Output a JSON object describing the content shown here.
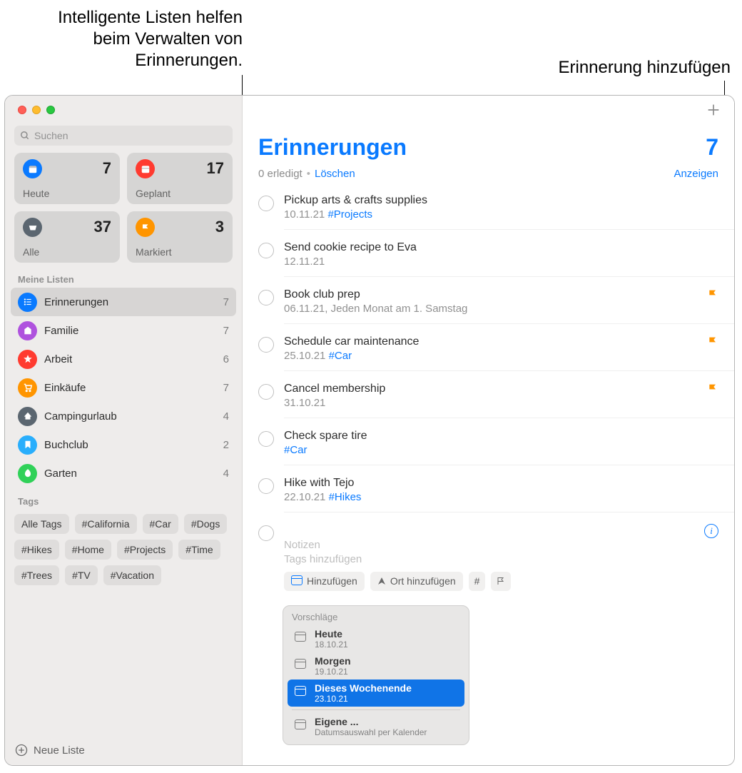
{
  "callouts": {
    "smart_lists": "Intelligente Listen helfen beim Verwalten von Erinnerungen.",
    "add_reminder": "Erinnerung hinzufügen"
  },
  "search": {
    "placeholder": "Suchen"
  },
  "smart": [
    {
      "label": "Heute",
      "count": "7",
      "color": "#0a7aff",
      "icon": "today"
    },
    {
      "label": "Geplant",
      "count": "17",
      "color": "#ff3b30",
      "icon": "scheduled"
    },
    {
      "label": "Alle",
      "count": "37",
      "color": "#5b6670",
      "icon": "all"
    },
    {
      "label": "Markiert",
      "count": "3",
      "color": "#ff9500",
      "icon": "flag"
    }
  ],
  "sections": {
    "lists": "Meine Listen",
    "tags": "Tags"
  },
  "lists": [
    {
      "label": "Erinnerungen",
      "count": "7",
      "color": "#0a7aff",
      "selected": true
    },
    {
      "label": "Familie",
      "count": "7",
      "color": "#af52de",
      "selected": false
    },
    {
      "label": "Arbeit",
      "count": "6",
      "color": "#ff3b30",
      "selected": false
    },
    {
      "label": "Einkäufe",
      "count": "7",
      "color": "#ff9500",
      "selected": false
    },
    {
      "label": "Campingurlaub",
      "count": "4",
      "color": "#5b6670",
      "selected": false
    },
    {
      "label": "Buchclub",
      "count": "2",
      "color": "#29aefc",
      "selected": false
    },
    {
      "label": "Garten",
      "count": "4",
      "color": "#30d158",
      "selected": false
    }
  ],
  "tags": [
    "Alle Tags",
    "#California",
    "#Car",
    "#Dogs",
    "#Hikes",
    "#Home",
    "#Projects",
    "#Time",
    "#Trees",
    "#TV",
    "#Vacation"
  ],
  "new_list": "Neue Liste",
  "main": {
    "title": "Erinnerungen",
    "count": "7",
    "done_text": "0 erledigt",
    "clear": "Löschen",
    "show": "Anzeigen"
  },
  "reminders": [
    {
      "title": "Pickup arts & crafts supplies",
      "meta": "10.11.21",
      "tag": "#Projects",
      "flag": false
    },
    {
      "title": "Send cookie recipe to Eva",
      "meta": "12.11.21",
      "tag": "",
      "flag": false
    },
    {
      "title": "Book club prep",
      "meta": "06.11.21, Jeden Monat am 1. Samstag",
      "tag": "",
      "flag": true
    },
    {
      "title": "Schedule car maintenance",
      "meta": "25.10.21",
      "tag": "#Car",
      "flag": true
    },
    {
      "title": "Cancel membership",
      "meta": "31.10.21",
      "tag": "",
      "flag": true
    },
    {
      "title": "Check spare tire",
      "meta": "",
      "tag": "#Car",
      "flag": false
    },
    {
      "title": "Hike with Tejo",
      "meta": "22.10.21",
      "tag": "#Hikes",
      "flag": false
    }
  ],
  "new_reminder": {
    "notes": "Notizen",
    "tags": "Tags hinzufügen",
    "chip_add": "Hinzufügen",
    "chip_location": "Ort hinzufügen"
  },
  "suggestions": {
    "head": "Vorschläge",
    "items": [
      {
        "title": "Heute",
        "sub": "18.10.21",
        "sel": false
      },
      {
        "title": "Morgen",
        "sub": "19.10.21",
        "sel": false
      },
      {
        "title": "Dieses Wochenende",
        "sub": "23.10.21",
        "sel": true
      }
    ],
    "custom": {
      "title": "Eigene ...",
      "sub": "Datumsauswahl per Kalender"
    }
  }
}
